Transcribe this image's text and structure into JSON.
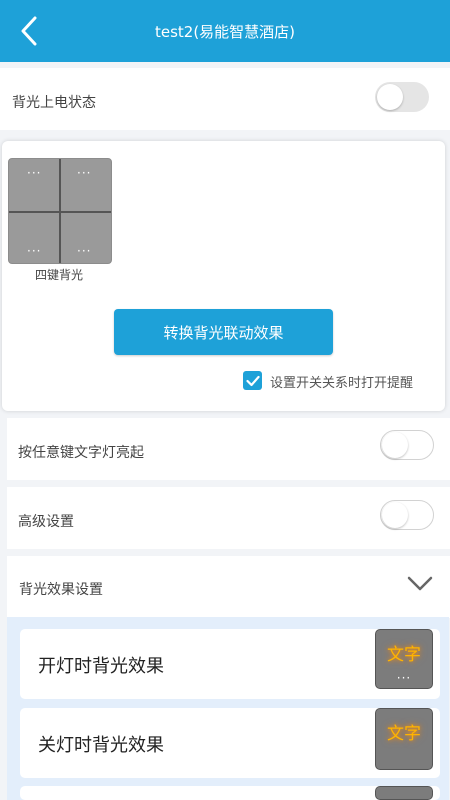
{
  "header": {
    "title": "test2(易能智慧酒店)"
  },
  "backlight_power": {
    "label": "背光上电状态"
  },
  "switch_tile": {
    "label": "四键背光",
    "key_dots": "···"
  },
  "convert_button": {
    "label": "转换背光联动效果"
  },
  "reminder": {
    "label": "设置开关关系时打开提醒",
    "checked": true
  },
  "any_key": {
    "label": "按任意键文字灯亮起"
  },
  "advanced": {
    "label": "高级设置"
  },
  "effect_settings": {
    "label": "背光效果设置"
  },
  "effects": [
    {
      "label": "开灯时背光效果",
      "preview_text": "文字",
      "dots": "···"
    },
    {
      "label": "关灯时背光效果",
      "preview_text": "文字"
    }
  ],
  "colors": {
    "accent": "#1ea1d8",
    "glow": "#ffb400"
  }
}
